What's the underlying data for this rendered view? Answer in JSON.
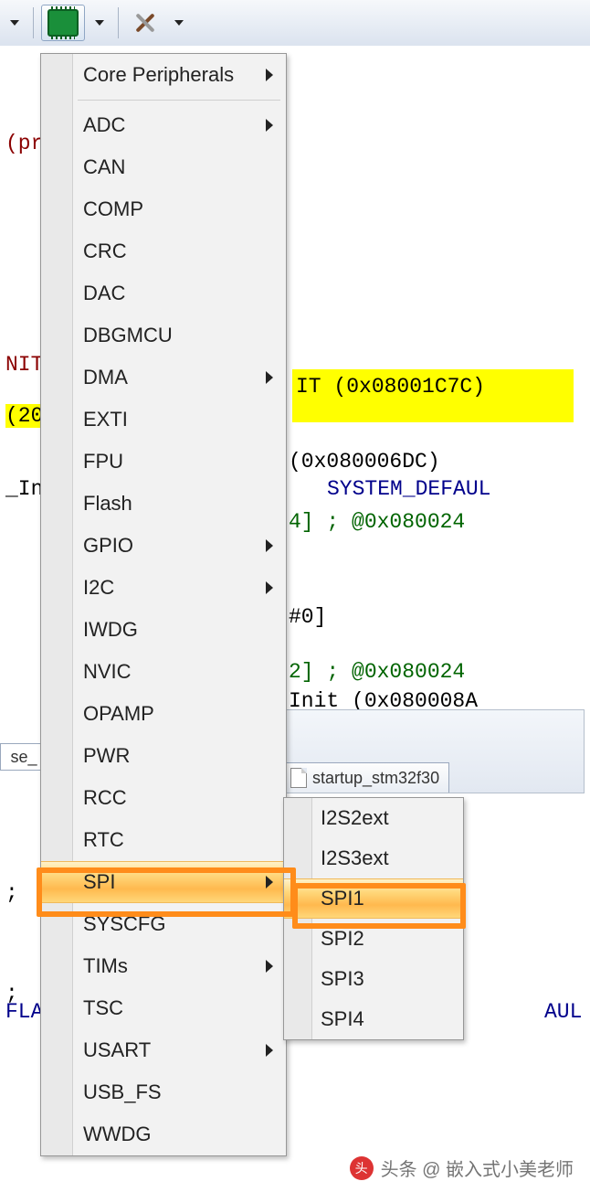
{
  "toolbar": {
    "chip_btn": "peripherals-dropdown",
    "tools_btn": "tools-dropdown"
  },
  "code": {
    "l1": "(pr",
    "l2": "NIT",
    "l2b": "IT (0x08001C7C)",
    "l3": "(20",
    "l4": "(0x080006DC)",
    "l5a": "_In",
    "l5b": "SYSTEM_DEFAUL",
    "l6": "4]  ; @0x080024",
    "l7": "#0]",
    "l8": "2]  ; @0x080024",
    "l9": "Init (0x080008A",
    "l10": ";",
    "l11": ";",
    "l12": "FLA",
    "l12b": "AUL"
  },
  "tabs": {
    "se": "se_",
    "file": "startup_stm32f30"
  },
  "menu": {
    "header": "Core Peripherals",
    "items": [
      {
        "label": "ADC",
        "sub": true
      },
      {
        "label": "CAN",
        "sub": false
      },
      {
        "label": "COMP",
        "sub": false
      },
      {
        "label": "CRC",
        "sub": false
      },
      {
        "label": "DAC",
        "sub": false
      },
      {
        "label": "DBGMCU",
        "sub": false
      },
      {
        "label": "DMA",
        "sub": true
      },
      {
        "label": "EXTI",
        "sub": false
      },
      {
        "label": "FPU",
        "sub": false
      },
      {
        "label": "Flash",
        "sub": false
      },
      {
        "label": "GPIO",
        "sub": true
      },
      {
        "label": "I2C",
        "sub": true
      },
      {
        "label": "IWDG",
        "sub": false
      },
      {
        "label": "NVIC",
        "sub": false
      },
      {
        "label": "OPAMP",
        "sub": false
      },
      {
        "label": "PWR",
        "sub": false
      },
      {
        "label": "RCC",
        "sub": false
      },
      {
        "label": "RTC",
        "sub": false
      },
      {
        "label": "SPI",
        "sub": true,
        "hover": true,
        "boxed": true
      },
      {
        "label": "SYSCFG",
        "sub": false
      },
      {
        "label": "TIMs",
        "sub": true
      },
      {
        "label": "TSC",
        "sub": false
      },
      {
        "label": "USART",
        "sub": true
      },
      {
        "label": "USB_FS",
        "sub": false
      },
      {
        "label": "WWDG",
        "sub": false
      }
    ]
  },
  "submenu": {
    "items": [
      {
        "label": "I2S2ext"
      },
      {
        "label": "I2S3ext"
      },
      {
        "label": "SPI1",
        "hover": true,
        "boxed": true
      },
      {
        "label": "SPI2"
      },
      {
        "label": "SPI3"
      },
      {
        "label": "SPI4"
      }
    ]
  },
  "watermark": {
    "text": "头条 @ 嵌入式小美老师"
  }
}
